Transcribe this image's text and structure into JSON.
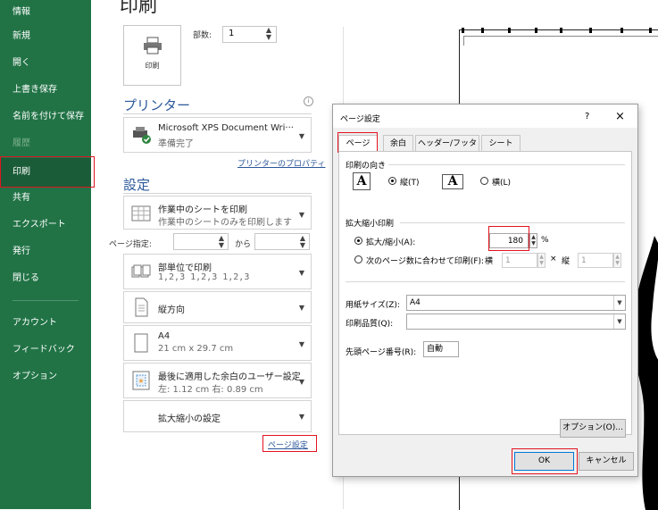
{
  "nav": {
    "items": [
      "情報",
      "新規",
      "開く",
      "上書き保存",
      "名前を付けて保存",
      "履歴",
      "印刷",
      "共有",
      "エクスポート",
      "発行",
      "閉じる",
      "アカウント",
      "フィードバック",
      "オプション"
    ],
    "selected": "印刷"
  },
  "print": {
    "title": "印刷",
    "print_button_label": "印刷",
    "copies_label": "部数:",
    "copies_value": "1",
    "printer_heading": "プリンター",
    "printer_name": "Microsoft XPS Document Wri···",
    "printer_status": "準備完了",
    "printer_properties_link": "プリンターのプロパティ",
    "settings_heading": "設定",
    "sheets_line1": "作業中のシートを印刷",
    "sheets_line2": "作業中のシートのみを印刷します",
    "pages_label": "ページ指定:",
    "pages_from": "",
    "pages_to_label": "から",
    "pages_to": "",
    "collate_line1": "部単位で印刷",
    "collate_line2": "1,2,3   1,2,3   1,2,3",
    "orientation": "縦方向",
    "paper_line1": "A4",
    "paper_line2": "21 cm x 29.7 cm",
    "margins_line1": "最後に適用した余白のユーザー設定",
    "margins_line2": "左: 1.12 cm   右: 0.89 cm",
    "scaling": "拡大縮小の設定",
    "page_setup_link": "ページ設定"
  },
  "dialog": {
    "title": "ページ設定",
    "help": "?",
    "close": "×",
    "tabs": [
      "ページ",
      "余白",
      "ヘッダー/フッター",
      "シート"
    ],
    "active_tab": "ページ",
    "orientation_group": "印刷の向き",
    "portrait_label": "縦(T)",
    "landscape_label": "横(L)",
    "orientation_icon_letter": "A",
    "scaling_group": "拡大縮小印刷",
    "adjust_label": "拡大/縮小(A):",
    "adjust_value": "180",
    "percent": "%",
    "fit_label": "次のページ数に合わせて印刷(F):",
    "fit_wide_label": "横",
    "fit_wide_value": "1",
    "fit_by": "×",
    "fit_tall_label": "縦",
    "fit_tall_value": "1",
    "paper_size_label": "用紙サイズ(Z):",
    "paper_size_value": "A4",
    "print_quality_label": "印刷品質(Q):",
    "print_quality_value": "",
    "first_page_label": "先頭ページ番号(R):",
    "first_page_value": "自動",
    "options_button": "オプション(O)...",
    "ok_button": "OK",
    "cancel_button": "キャンセル"
  }
}
